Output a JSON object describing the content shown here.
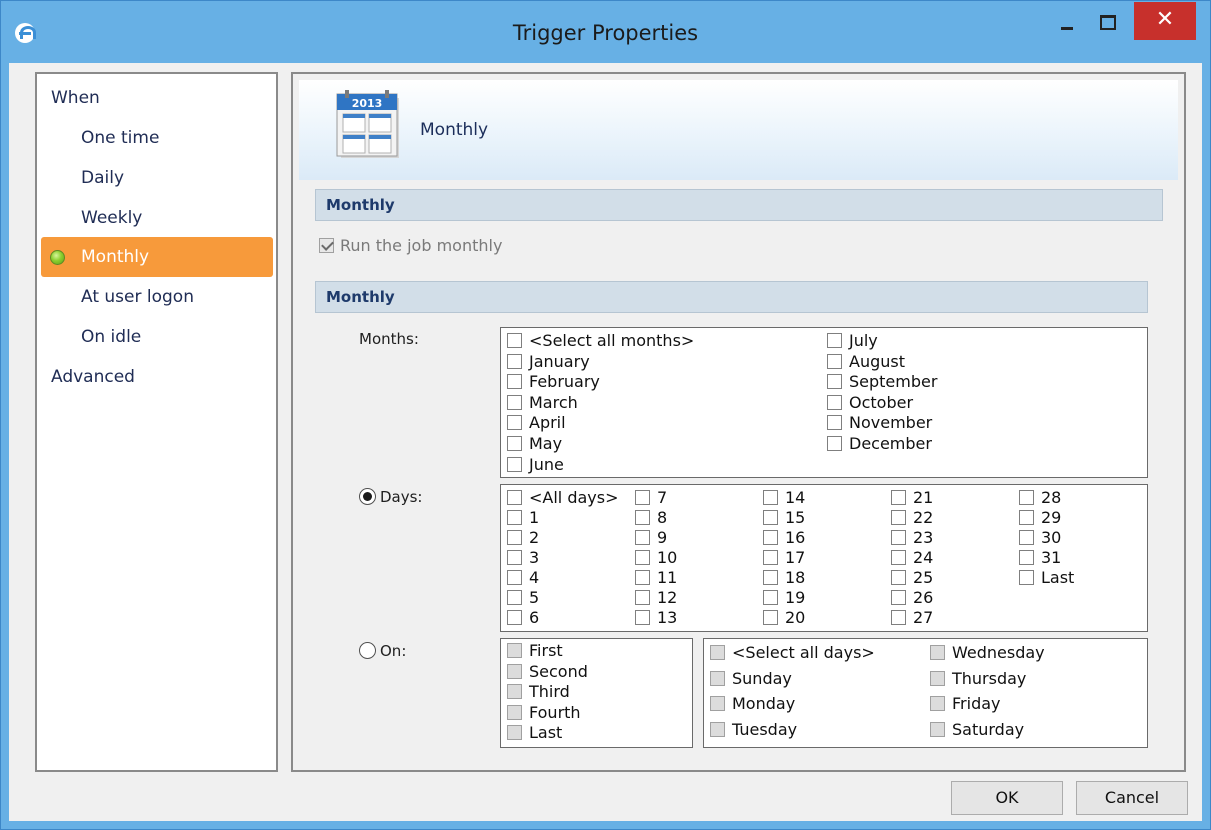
{
  "window": {
    "title": "Trigger Properties",
    "close_glyph": "✕"
  },
  "nav": {
    "items": [
      {
        "label": "When"
      },
      {
        "label": "One time"
      },
      {
        "label": "Daily"
      },
      {
        "label": "Weekly"
      },
      {
        "label": "Monthly"
      },
      {
        "label": "At user logon"
      },
      {
        "label": "On idle"
      },
      {
        "label": "Advanced"
      }
    ],
    "selected": "Monthly"
  },
  "header": {
    "title": "Monthly",
    "calendar_year": "2013",
    "icon": "calendar-icon"
  },
  "section1": {
    "title": "Monthly",
    "run_monthly_label": "Run the job monthly",
    "run_monthly_checked": true
  },
  "section2": {
    "title": "Monthly",
    "months_label": "Months:",
    "days_label": "Days:",
    "on_label": "On:",
    "selected_mode": "Days"
  },
  "months": {
    "col1": [
      "<Select all months>",
      "January",
      "February",
      "March",
      "April",
      "May",
      "June"
    ],
    "col2": [
      "July",
      "August",
      "September",
      "October",
      "November",
      "December"
    ]
  },
  "days": {
    "col1": [
      "<All days>",
      "1",
      "2",
      "3",
      "4",
      "5",
      "6"
    ],
    "col2": [
      "7",
      "8",
      "9",
      "10",
      "11",
      "12",
      "13"
    ],
    "col3": [
      "14",
      "15",
      "16",
      "17",
      "18",
      "19",
      "20"
    ],
    "col4": [
      "21",
      "22",
      "23",
      "24",
      "25",
      "26",
      "27"
    ],
    "col5": [
      "28",
      "29",
      "30",
      "31",
      "Last"
    ]
  },
  "on": {
    "ordinals": [
      "First",
      "Second",
      "Third",
      "Fourth",
      "Last"
    ],
    "weekdays_col1": [
      "<Select all days>",
      "Sunday",
      "Monday",
      "Tuesday"
    ],
    "weekdays_col2": [
      "Wednesday",
      "Thursday",
      "Friday",
      "Saturday"
    ]
  },
  "buttons": {
    "ok": "OK",
    "cancel": "Cancel"
  }
}
